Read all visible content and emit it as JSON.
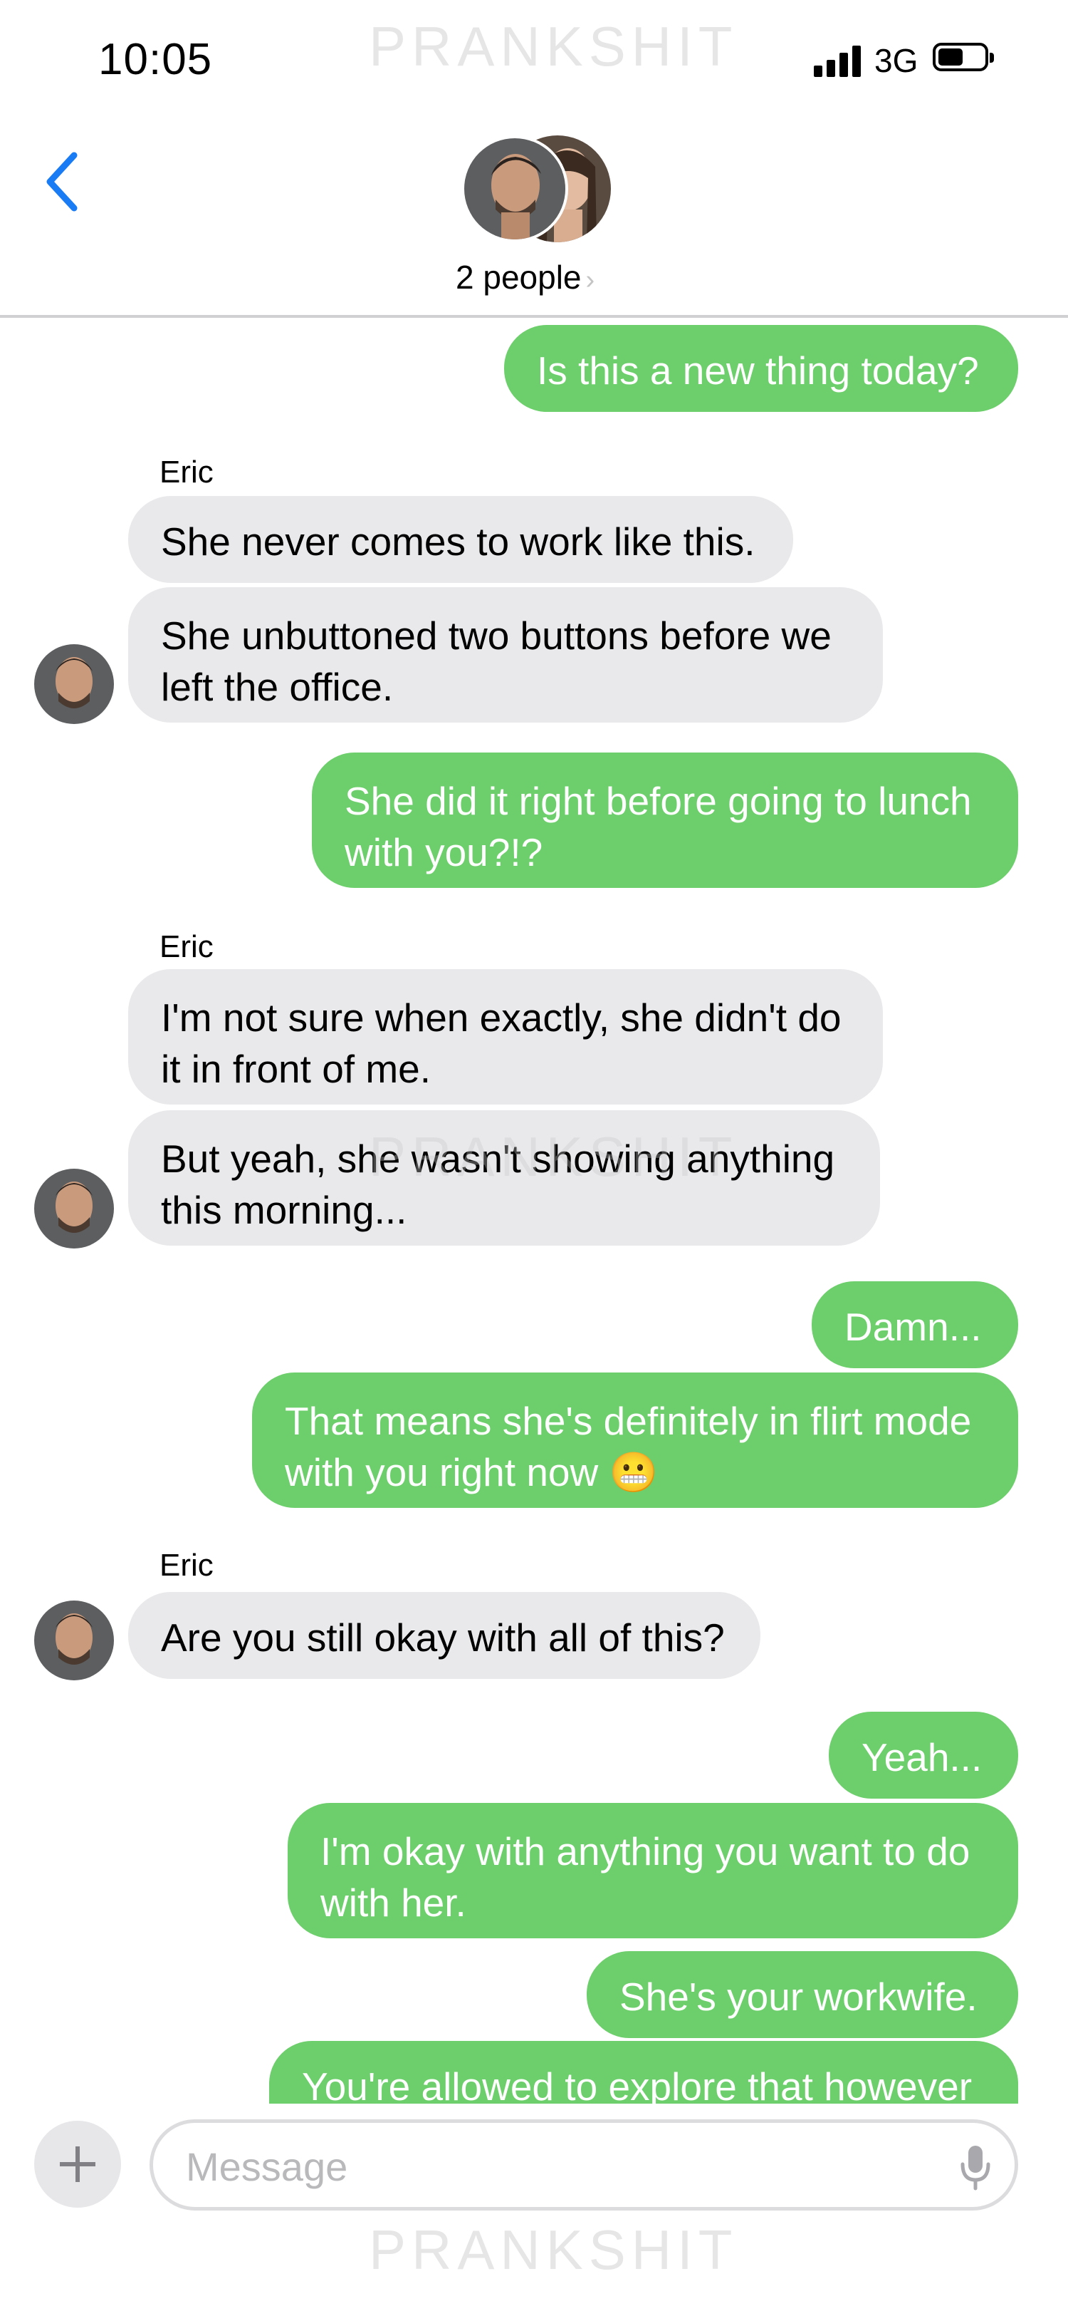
{
  "status_bar": {
    "time": "10:05",
    "network": "3G",
    "watermark_top": "PRANKSHIT"
  },
  "header": {
    "subtitle": "2 people",
    "chevron": "›"
  },
  "messages": [
    {
      "dir": "out",
      "text": "Is this a new thing today?"
    },
    {
      "sender": "Eric"
    },
    {
      "dir": "in",
      "text": "She never comes to work like this."
    },
    {
      "dir": "in",
      "text": "She unbuttoned two buttons before we left the office."
    },
    {
      "dir": "out",
      "text": "She did it right before going to lunch with you?!?"
    },
    {
      "sender": "Eric"
    },
    {
      "dir": "in",
      "text": "I'm not sure when exactly, she didn't do it in front of me."
    },
    {
      "dir": "in",
      "text": "But yeah, she wasn't showing anything this morning..."
    },
    {
      "dir": "out",
      "text": "Damn..."
    },
    {
      "dir": "out",
      "text": "That means she's definitely in flirt mode with you right now 😬"
    },
    {
      "sender": "Eric"
    },
    {
      "dir": "in",
      "text": "Are you still okay with all of this?"
    },
    {
      "dir": "out",
      "text": "Yeah..."
    },
    {
      "dir": "out",
      "text": "I'm okay with anything you want to do with her."
    },
    {
      "dir": "out",
      "text": "She's your workwife."
    },
    {
      "dir": "out",
      "text": "You're allowed to explore that however"
    }
  ],
  "watermark_middle": "PRANKSHIT",
  "composer": {
    "placeholder": "Message"
  },
  "watermark_bottom": "PRANKSHIT",
  "colors": {
    "outgoing": "#6ccf6b",
    "incoming": "#e9e9eb",
    "accent": "#1a7cf5"
  },
  "icons": [
    "back-chevron-icon",
    "signal-icon",
    "battery-icon",
    "plus-icon",
    "microphone-icon"
  ]
}
